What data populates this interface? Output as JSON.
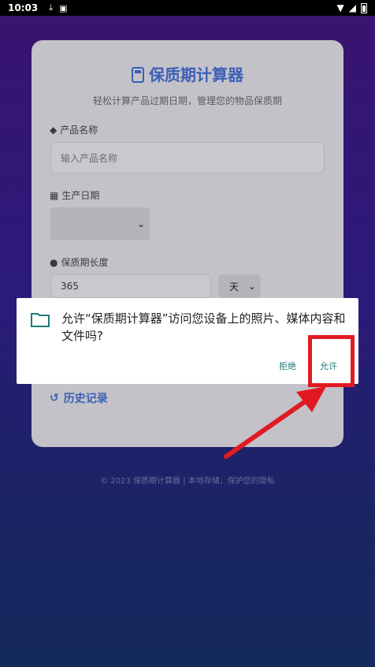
{
  "status_bar": {
    "time": "10:03"
  },
  "app": {
    "title": "保质期计算器",
    "subtitle": "轻松计算产品过期日期，管理您的物品保质期",
    "product_label": "产品名称",
    "product_placeholder": "输入产品名称",
    "date_label": "生产日期",
    "shelf_label": "保质期长度",
    "shelf_value": "365",
    "unit_value": "天",
    "history_label": "历史记录",
    "footer": "© 2023 保质期计算器 | 本地存储，保护您的隐私"
  },
  "dialog": {
    "message": "允许“保质期计算器”访问您设备上的照片、媒体内容和文件吗?",
    "deny_label": "拒绝",
    "allow_label": "允许"
  },
  "colors": {
    "accent": "#3c5fb6",
    "dialog_button": "#1f7a7a",
    "annotation": "#e11a22"
  }
}
